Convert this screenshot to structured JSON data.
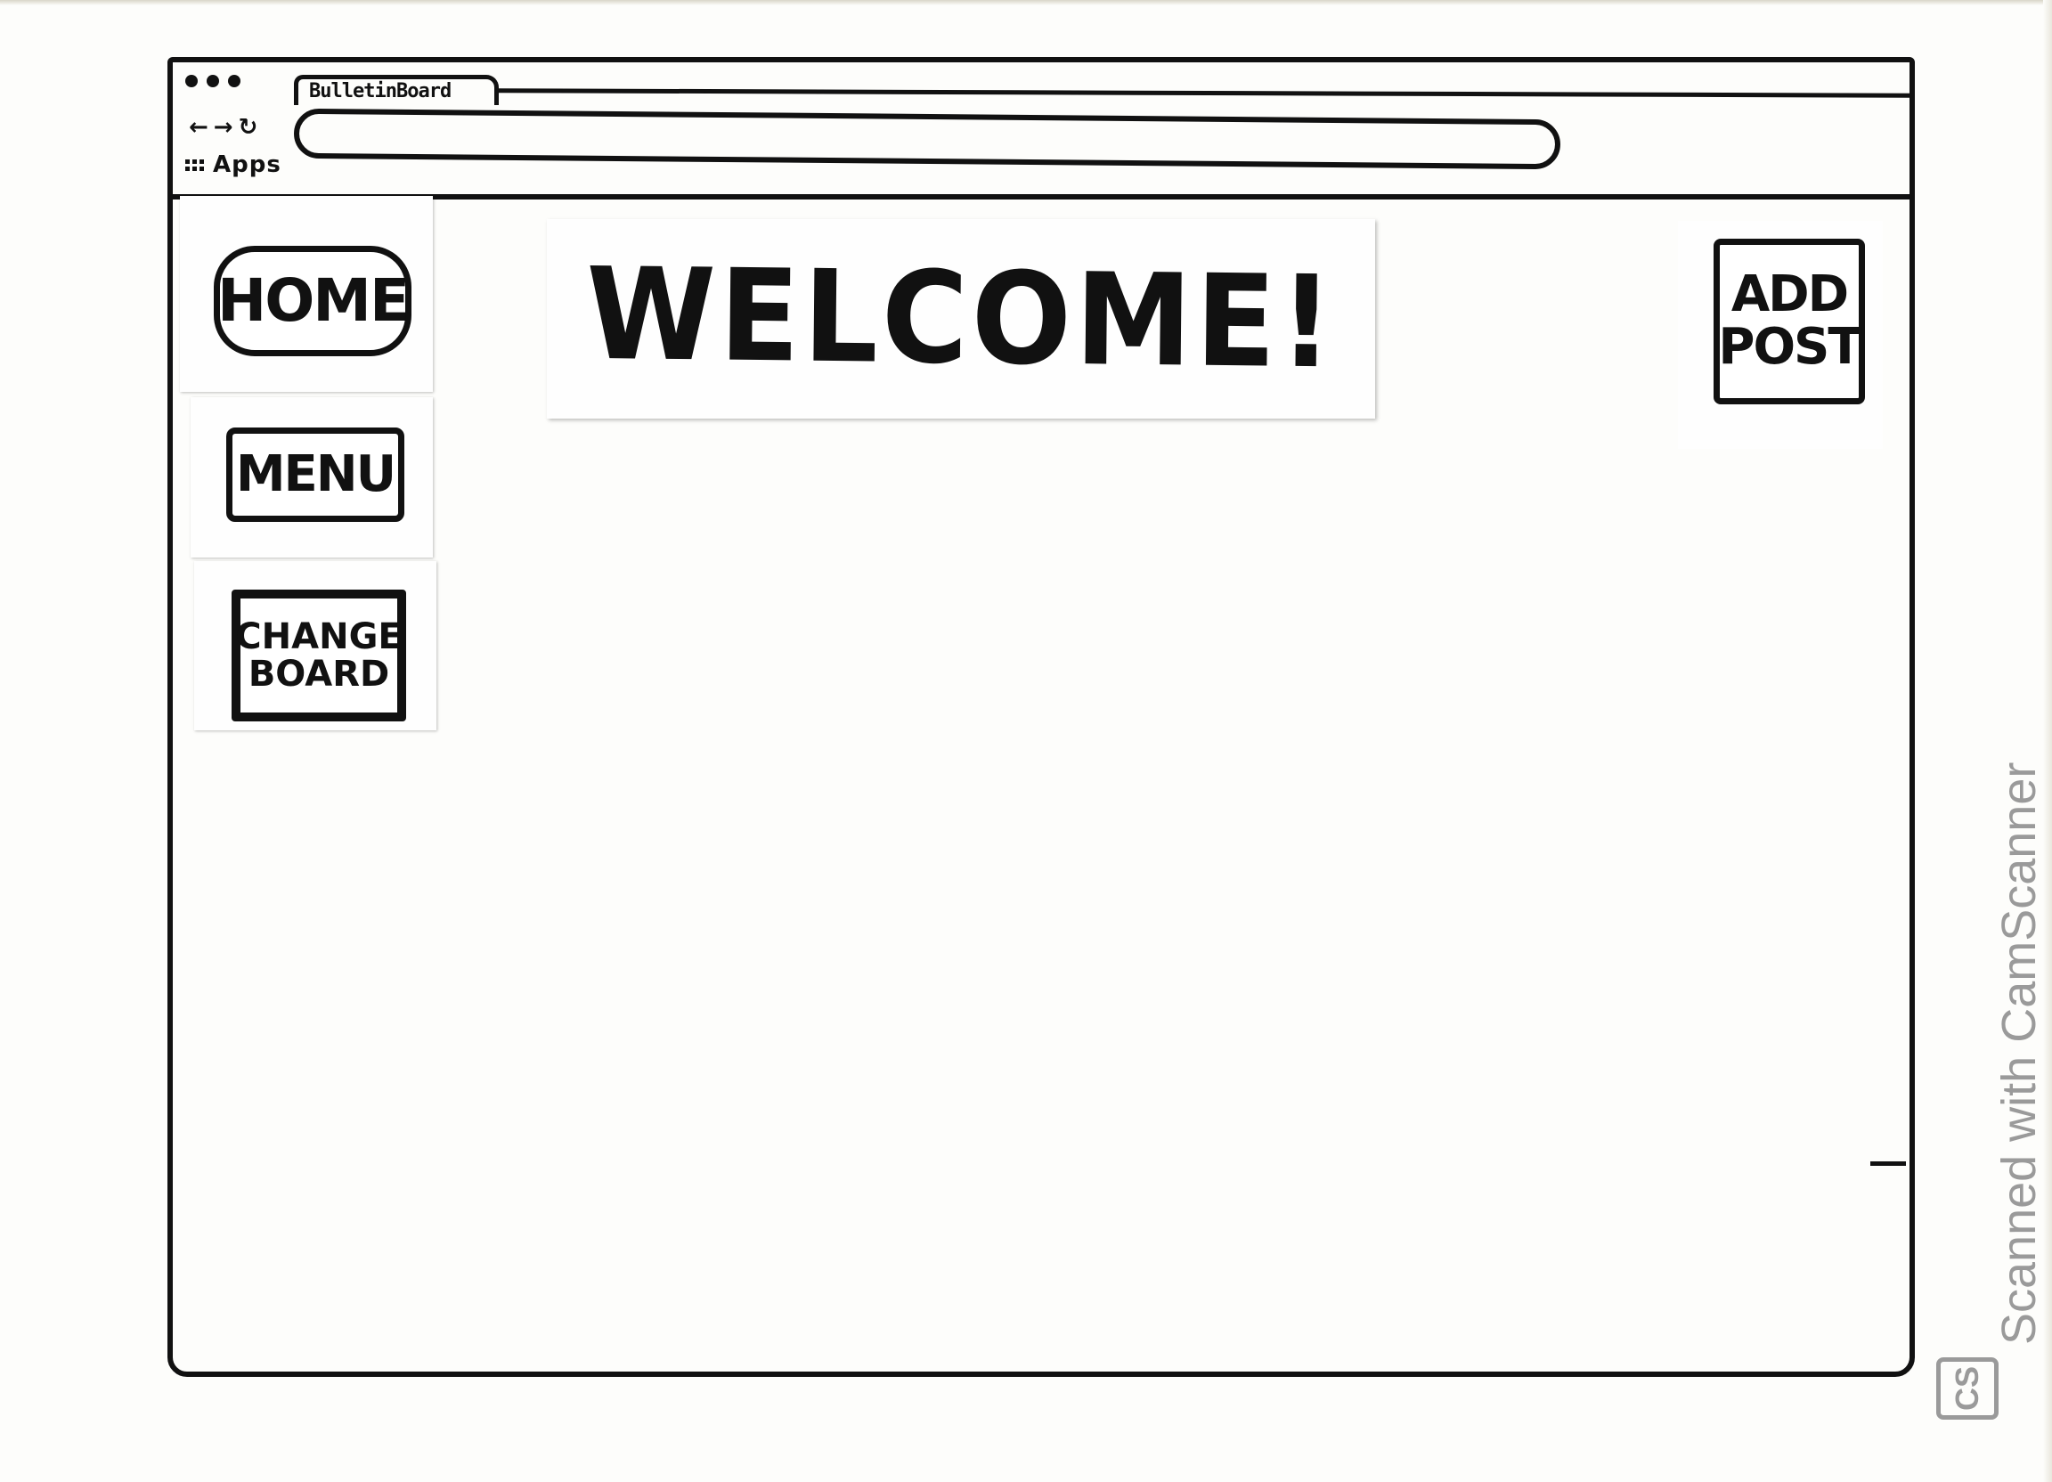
{
  "browser": {
    "tab_title": "BulletinBoard",
    "bookmarks_label": "Apps"
  },
  "sidebar": {
    "home_label": "HOME",
    "menu_label": "MENU",
    "change_board_label": "CHANGE\nBOARD"
  },
  "main": {
    "welcome_title": "WELCOME!",
    "add_post_label": "ADD\nPOST"
  },
  "watermark": {
    "text": "Scanned with CamScanner",
    "logo": "CS"
  }
}
